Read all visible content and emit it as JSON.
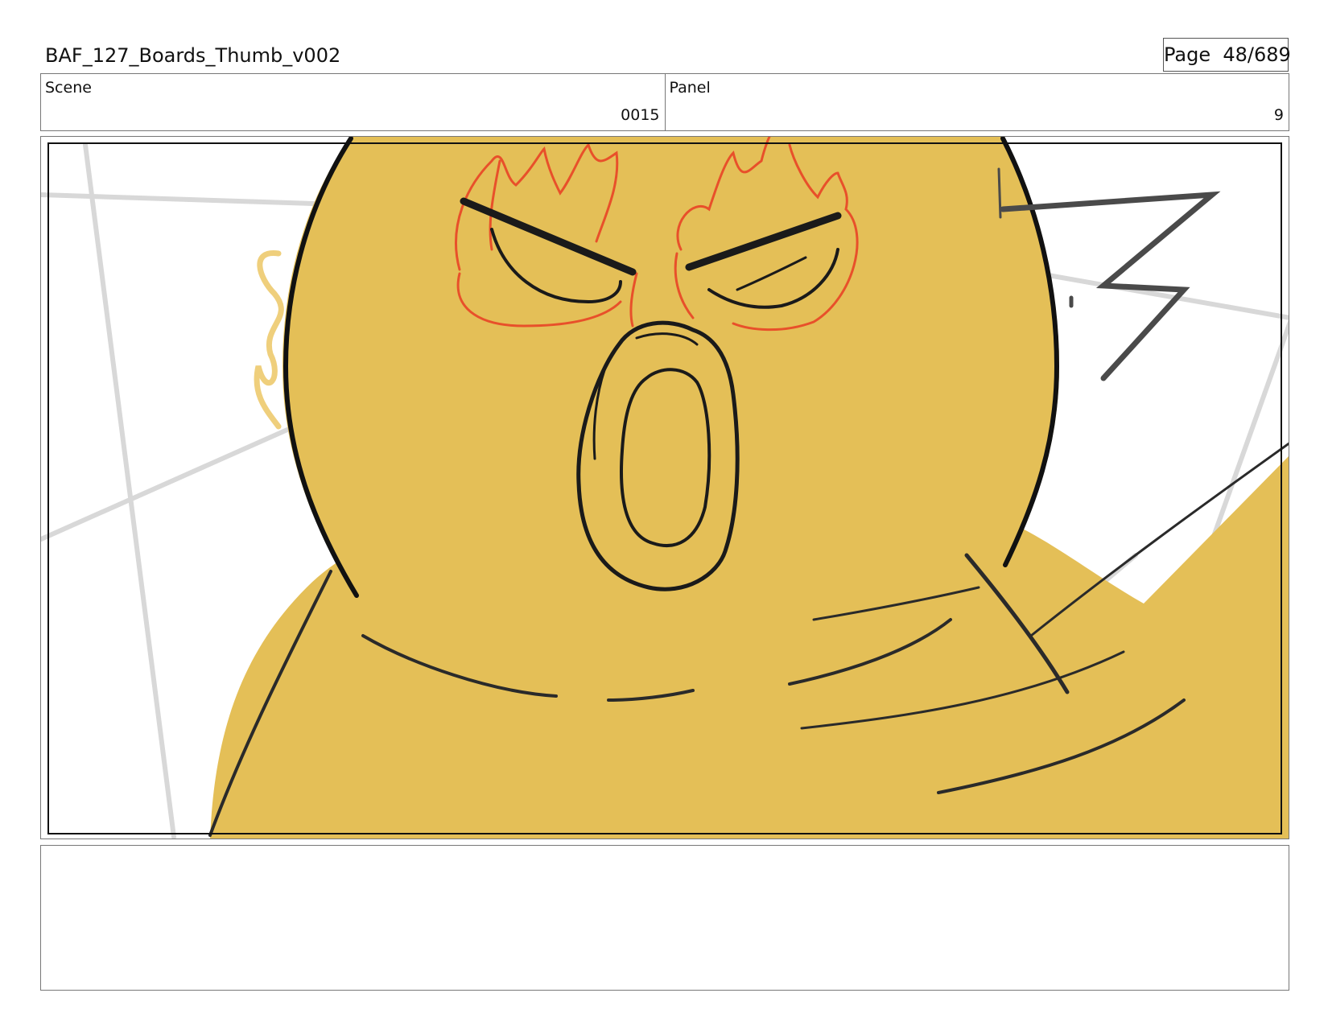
{
  "document": {
    "title": "BAF_127_Boards_Thumb_v002",
    "page_label": "Page  48/689"
  },
  "header": {
    "scene_label": "Scene",
    "scene_value": "0015",
    "panel_label": "Panel",
    "panel_value": "9"
  },
  "panel": {
    "subject": "yellow character face close-up, shouting, angry brows",
    "colors": {
      "character_fill": "#e4bf57",
      "outline": "#111111",
      "anger_marks": "#e8502a",
      "steam_wisp": "#f0cf7a",
      "background_lines": "#d6d6d6"
    }
  },
  "notes": {
    "text": ""
  }
}
